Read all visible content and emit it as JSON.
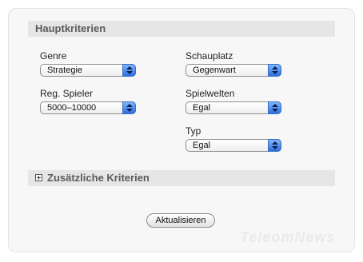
{
  "sections": {
    "main_title": "Hauptkriterien",
    "extra_title": "Zusätzliche Kriterien"
  },
  "fields": {
    "genre": {
      "label": "Genre",
      "value": "Strategie"
    },
    "schauplatz": {
      "label": "Schauplatz",
      "value": "Gegenwart"
    },
    "reg_spieler": {
      "label": "Reg. Spieler",
      "value": "5000–10000"
    },
    "spielwelten": {
      "label": "Spielwelten",
      "value": "Egal"
    },
    "typ": {
      "label": "Typ",
      "value": "Egal"
    }
  },
  "actions": {
    "update_label": "Aktualisieren"
  },
  "watermark": "TeleomNews",
  "icons": {
    "expand": "plus-box-icon",
    "select_arrows": "updown-arrows-icon"
  },
  "colors": {
    "accent": "#2f6fe0",
    "section_bg": "#e6e6e6",
    "section_text": "#5a5a5a"
  }
}
